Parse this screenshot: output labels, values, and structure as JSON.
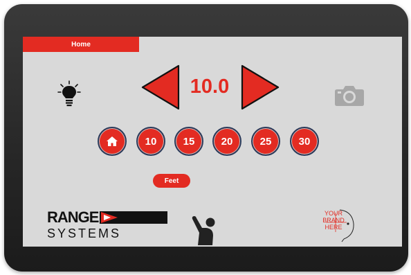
{
  "header": {
    "home_label": "Home"
  },
  "speed": {
    "value": "10.0"
  },
  "distances": [
    {
      "label": "",
      "icon": "home-icon"
    },
    {
      "label": "10"
    },
    {
      "label": "15"
    },
    {
      "label": "20"
    },
    {
      "label": "25"
    },
    {
      "label": "30"
    }
  ],
  "units": {
    "label": "Feet"
  },
  "logo": {
    "range": "RANGE",
    "systems": "SYSTEMS"
  },
  "brand": {
    "line1": "YOUR",
    "line2": "BRAND",
    "line3": "HERE"
  },
  "icons": {
    "light": "lightbulb-icon",
    "camera": "camera-icon",
    "wave": "waving-person-icon"
  },
  "colors": {
    "accent": "#e32b22",
    "screen_bg": "#d9d9d9",
    "device": "#2a2a2a"
  }
}
